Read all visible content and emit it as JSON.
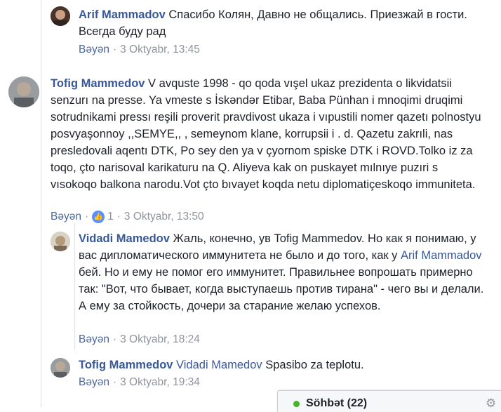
{
  "comments": [
    {
      "author": "Arif Mammadov",
      "text": "Спасибо Колян, Давно не общались. Приезжай в гости. Всегда буду рад",
      "reply_label": "Bəyən",
      "timestamp": "3 Oktyabr, 13:45"
    },
    {
      "author": "Tofig Mammedov",
      "text": "V avquste 1998 - qo qoda vışel ukaz prezidenta o likvidatsii senzurı na presse. Ya vmeste s İskəndər Etibar, Baba Pünhan i mnoqimi druqimi sotrudnikami pressı reşili proverit pravdivost ukaza i vıpustili nomer qazetı polnostyu posvyaşonnoy ,,SEMYE,, , semeynom klane, korrupsii i . d. Qazetu zakrıli, nas presledovali aqentı DTK, Po sey den ya v çyornom spiske DTK i ROVD.Tolko iz za toqo, çto narisoval karikaturu na Q. Aliyeva kak on puskayet mılnıye puzıri s vısokoqo balkona narodu.Vot çto bıvayet koqda netu diplomatiçeskoqo immuniteta.",
      "reply_label": "Bəyən",
      "like_count": "1",
      "timestamp": "3 Oktyabr, 13:50"
    },
    {
      "author": "Vidadi Mamedov",
      "text_before_mention": "Жаль, конечно, ув Tofig Mammedov. Но как я понимаю, у вас дипломатического иммунитета не было и до того, как у ",
      "mention": "Arif Mammadov",
      "text_after_mention": " бей. Но и ему не помог его иммунитет. Правильнее вопрошать примерно так: \"Вот, что бывает, когда выступаешь против тирана\" - чего вы и делали. А ему за стойкость, дочери за старание желаю успехов.",
      "reply_label": "Bəyən",
      "timestamp": "3 Oktyabr, 18:24"
    },
    {
      "author": "Tofig Mammedov",
      "mention": "Vidadi Mamedov",
      "text": " Spasibo za teplotu.",
      "reply_label": "Bəyən",
      "timestamp": "3 Oktyabr, 19:34"
    }
  ],
  "chat": {
    "label": "Söhbət (22)",
    "status_color": "#42b72a"
  },
  "colors": {
    "link": "#385898",
    "meta": "#90949c",
    "text": "#1d2129"
  }
}
